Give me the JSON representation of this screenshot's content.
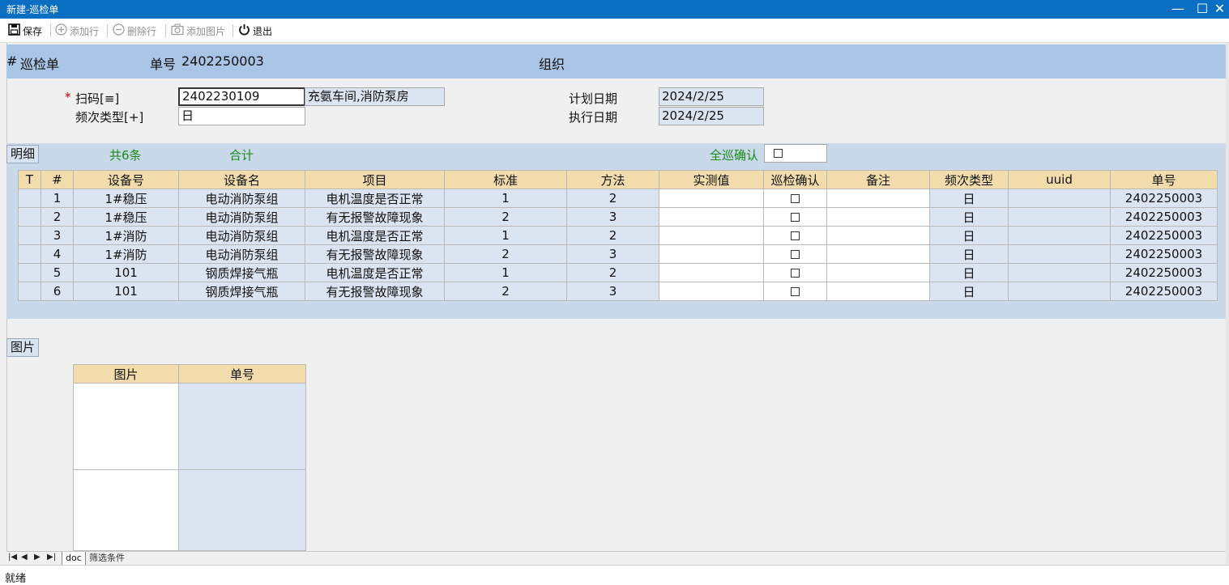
{
  "window": {
    "title": "新建-巡检单"
  },
  "toolbar": {
    "save": "保存",
    "add_row": "添加行",
    "delete_row": "删除行",
    "add_image": "添加图片",
    "exit": "退出"
  },
  "header": {
    "hash": "#",
    "title": "巡检单",
    "order_no_label": "单号",
    "order_no": "2402250003",
    "org_label": "组织"
  },
  "form": {
    "required_mark": "*",
    "scan_label": "扫码[≡]",
    "scan_value": "2402230109",
    "location": "充氨车间,消防泵房",
    "freq_label": "频次类型[+]",
    "freq_value": "日",
    "plan_date_label": "计划日期",
    "plan_date": "2024/2/25",
    "exec_date_label": "执行日期",
    "exec_date": "2024/2/25"
  },
  "detail": {
    "tab": "明细",
    "count": "共6条",
    "total": "合计",
    "confirm_all": "全巡确认",
    "columns": [
      "T",
      "#",
      "设备号",
      "设备名",
      "项目",
      "标准",
      "方法",
      "实测值",
      "巡检确认",
      "备注",
      "频次类型",
      "uuid",
      "单号"
    ],
    "rows": [
      {
        "n": "1",
        "device_no": "1#稳压",
        "device_name": "电动消防泵组",
        "item": "电机温度是否正常",
        "standard": "1",
        "method": "2",
        "freq": "日",
        "order": "2402250003"
      },
      {
        "n": "2",
        "device_no": "1#稳压",
        "device_name": "电动消防泵组",
        "item": "有无报警故障现象",
        "standard": "2",
        "method": "3",
        "freq": "日",
        "order": "2402250003"
      },
      {
        "n": "3",
        "device_no": "1#消防",
        "device_name": "电动消防泵组",
        "item": "电机温度是否正常",
        "standard": "1",
        "method": "2",
        "freq": "日",
        "order": "2402250003"
      },
      {
        "n": "4",
        "device_no": "1#消防",
        "device_name": "电动消防泵组",
        "item": "有无报警故障现象",
        "standard": "2",
        "method": "3",
        "freq": "日",
        "order": "2402250003"
      },
      {
        "n": "5",
        "device_no": "101",
        "device_name": "钢质焊接气瓶",
        "item": "电机温度是否正常",
        "standard": "1",
        "method": "2",
        "freq": "日",
        "order": "2402250003"
      },
      {
        "n": "6",
        "device_no": "101",
        "device_name": "钢质焊接气瓶",
        "item": "有无报警故障现象",
        "standard": "2",
        "method": "3",
        "freq": "日",
        "order": "2402250003"
      }
    ]
  },
  "images": {
    "tab": "图片",
    "columns": [
      "图片",
      "单号"
    ]
  },
  "sheets": [
    "doc",
    "筛选条件"
  ],
  "status": "就绪"
}
